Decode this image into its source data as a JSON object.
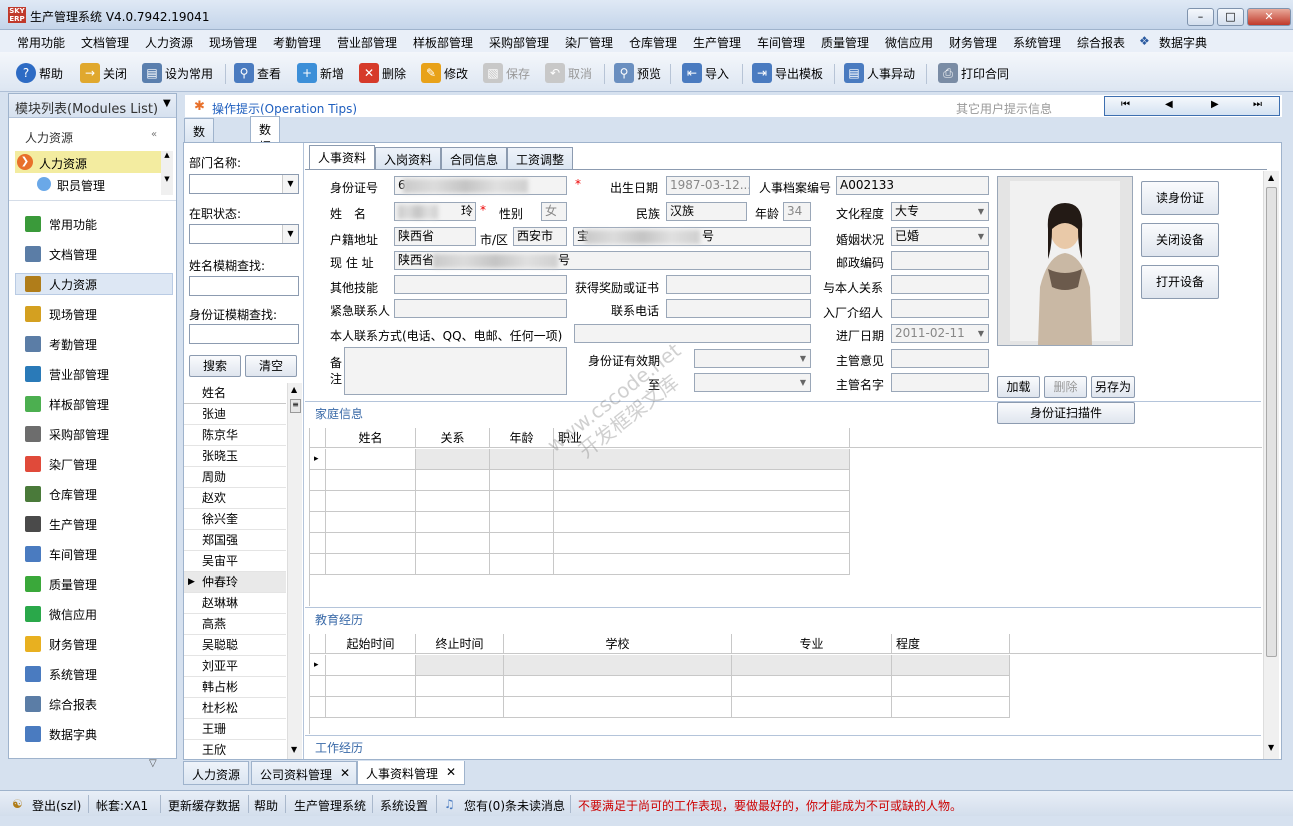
{
  "window": {
    "title": "生产管理系统 V4.0.7942.19041",
    "icon_text": "SKYERP"
  },
  "menu": [
    "常用功能",
    "文档管理",
    "人力资源",
    "现场管理",
    "考勤管理",
    "营业部管理",
    "样板部管理",
    "采购部管理",
    "染厂管理",
    "仓库管理",
    "生产管理",
    "车间管理",
    "质量管理",
    "微信应用",
    "财务管理",
    "系统管理",
    "综合报表",
    "数据字典"
  ],
  "toolbar": {
    "help": "帮助",
    "close": "关闭",
    "set_common": "设为常用",
    "view": "查看",
    "add": "新增",
    "delete": "删除",
    "edit": "修改",
    "save": "保存",
    "cancel": "取消",
    "preview": "预览",
    "import": "导入",
    "export_template": "导出模板",
    "personnel_change": "人事异动",
    "print_contract": "打印合同"
  },
  "left_panel": {
    "header": "模块列表(Modules List)",
    "group": "人力资源",
    "tree_parent": "人力资源",
    "tree_child": "职员管理",
    "modules": [
      "常用功能",
      "文档管理",
      "人力资源",
      "现场管理",
      "考勤管理",
      "营业部管理",
      "样板部管理",
      "采购部管理",
      "染厂管理",
      "仓库管理",
      "生产管理",
      "车间管理",
      "质量管理",
      "微信应用",
      "财务管理",
      "系统管理",
      "综合报表",
      "数据字典"
    ],
    "selected": "人力资源"
  },
  "tips": {
    "link": "操作提示(Operation Tips)",
    "other": "其它用户提示信息"
  },
  "outer_tabs": [
    "数据查询",
    "数据编辑"
  ],
  "search": {
    "dept_label": "部门名称:",
    "status_label": "在职状态:",
    "name_label": "姓名模糊查找:",
    "id_label": "身份证模糊查找:",
    "search_btn": "搜索",
    "clear_btn": "清空",
    "name_header": "姓名",
    "names": [
      "张迪",
      "陈京华",
      "张晓玉",
      "周勋",
      "赵欢",
      "徐兴奎",
      "郑国强",
      "吴宙平",
      "仲春玲",
      "赵琳琳",
      "高燕",
      "吴聪聪",
      "刘亚平",
      "韩占彬",
      "杜杉松",
      "王珊",
      "王欣"
    ],
    "current": "仲春玲"
  },
  "inner_tabs": [
    "人事资料",
    "入岗资料",
    "合同信息",
    "工资调整"
  ],
  "form": {
    "id_label": "身份证号",
    "id_value": "6",
    "birth_label": "出生日期",
    "birth_value": "1987-03-12...",
    "archive_label": "人事档案编号",
    "archive_value": "A002133",
    "name_label": "姓　名",
    "name_value": "玲",
    "gender_label": "性别",
    "gender_value": "女",
    "ethnic_label": "民族",
    "ethnic_value": "汉族",
    "age_label": "年龄",
    "age_value": "34",
    "edu_label": "文化程度",
    "edu_value": "大专",
    "hukou_label": "户籍地址",
    "hukou_value": "陕西省",
    "city_label": "市/区",
    "city_value": "西安市",
    "hukou_detail_tail": "号",
    "hukou_detail_head": "宝",
    "marital_label": "婚姻状况",
    "marital_value": "已婚",
    "addr_label": "现 住 址",
    "addr_value": "陕西省",
    "addr_tail": "号",
    "postal_label": "邮政编码",
    "skill_label": "其他技能",
    "award_label": "获得奖励或证书",
    "relation_label": "与本人关系",
    "emerg_label": "紧急联系人",
    "phone_label": "联系电话",
    "introducer_label": "入厂介绍人",
    "contact_label": "本人联系方式(电话、QQ、电邮、任何一项)",
    "join_label": "进厂日期",
    "join_value": "2011-02-11",
    "remark_label": "备注",
    "idvalid_label": "身份证有效期",
    "to_label": "至",
    "mgr_opinion_label": "主管意见",
    "mgr_sign_label": "主管名字"
  },
  "photo_buttons": {
    "load": "加载",
    "delete": "删除",
    "save_as": "另存为",
    "scan_plugin": "身份证扫描件"
  },
  "device_buttons": {
    "read_id": "读身份证",
    "close_device": "关闭设备",
    "open_device": "打开设备"
  },
  "family": {
    "title": "家庭信息",
    "headers": [
      "姓名",
      "关系",
      "年龄",
      "职业"
    ]
  },
  "education": {
    "title": "教育经历",
    "headers": [
      "起始时间",
      "终止时间",
      "学校",
      "专业",
      "程度"
    ]
  },
  "work": {
    "title": "工作经历"
  },
  "bottom_tabs": [
    "人力资源",
    "公司资料管理",
    "人事资料管理"
  ],
  "watermark": {
    "line1": "www.cscode.net",
    "line2": "开发框架文库"
  },
  "status": {
    "logout": "登出(szl)",
    "account": "帐套:XA1",
    "refresh": "更新缓存数据",
    "help": "帮助",
    "system": "生产管理系统",
    "settings": "系统设置",
    "messages": "您有(0)条未读消息",
    "motto": "不要满足于尚可的工作表现，要做最好的，你才能成为不可或缺的人物。"
  },
  "colors": {
    "accent": "#3a6aa8",
    "motto": "#cc0000",
    "required": "#ee0000",
    "selected_tree": "#f3eca0"
  }
}
